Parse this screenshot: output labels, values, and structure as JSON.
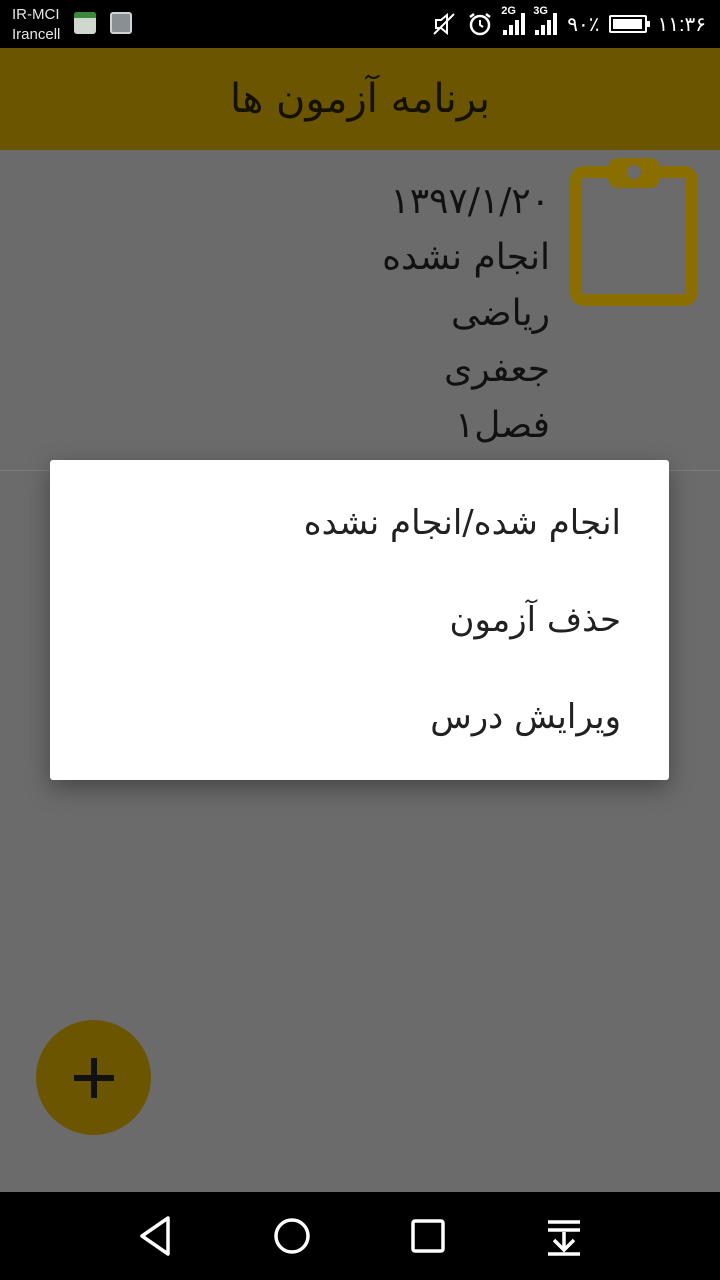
{
  "status_bar": {
    "carrier_line1": "IR-MCI",
    "carrier_line2": "Irancell",
    "network_1": "2G",
    "network_2": "3G",
    "battery_percent": "۹۰٪",
    "time": "۱۱:۳۶",
    "battery_level": 0.9
  },
  "app_bar": {
    "title": "برنامه آزمون ها"
  },
  "exam_item": {
    "date": "۱۳۹۷/۱/۲۰",
    "status": "انجام نشده",
    "subject": "ریاضی",
    "teacher": "جعفری",
    "chapter": "فصل۱",
    "icon": "clipboard-icon"
  },
  "dialog": {
    "items": [
      {
        "label": "انجام شده/انجام نشده"
      },
      {
        "label": "حذف آزمون"
      },
      {
        "label": "ویرایش درس"
      }
    ]
  },
  "fab": {
    "icon": "plus-icon"
  },
  "nav": {
    "back": "back-icon",
    "home": "home-icon",
    "recents": "recents-icon",
    "notifications": "notification-pull-icon"
  },
  "colors": {
    "accent": "#6b5500",
    "clipboard": "#8a6e00",
    "scrim_background": "#6b6b6b"
  }
}
